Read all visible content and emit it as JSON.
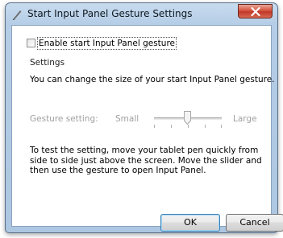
{
  "window": {
    "title": "Start Input Panel Gesture Settings",
    "close_icon": "close-icon",
    "app_icon": "pen-icon"
  },
  "enable_checkbox": {
    "label": "Enable start Input Panel gesture",
    "checked": false
  },
  "settings": {
    "heading": "Settings",
    "description": "You can change the size of your start Input Panel gesture."
  },
  "gesture_setting": {
    "label": "Gesture setting:",
    "min_label": "Small",
    "max_label": "Large",
    "enabled": false
  },
  "instructions": "To test the setting, move your tablet pen quickly from side to side just above the screen.  Move the slider and then use the gesture to open Input Panel.",
  "buttons": {
    "ok": "OK",
    "cancel": "Cancel"
  },
  "colors": {
    "titlebar": "#b5cde6",
    "close_button": "#c0392a",
    "disabled_text": "#a0a0a0"
  }
}
